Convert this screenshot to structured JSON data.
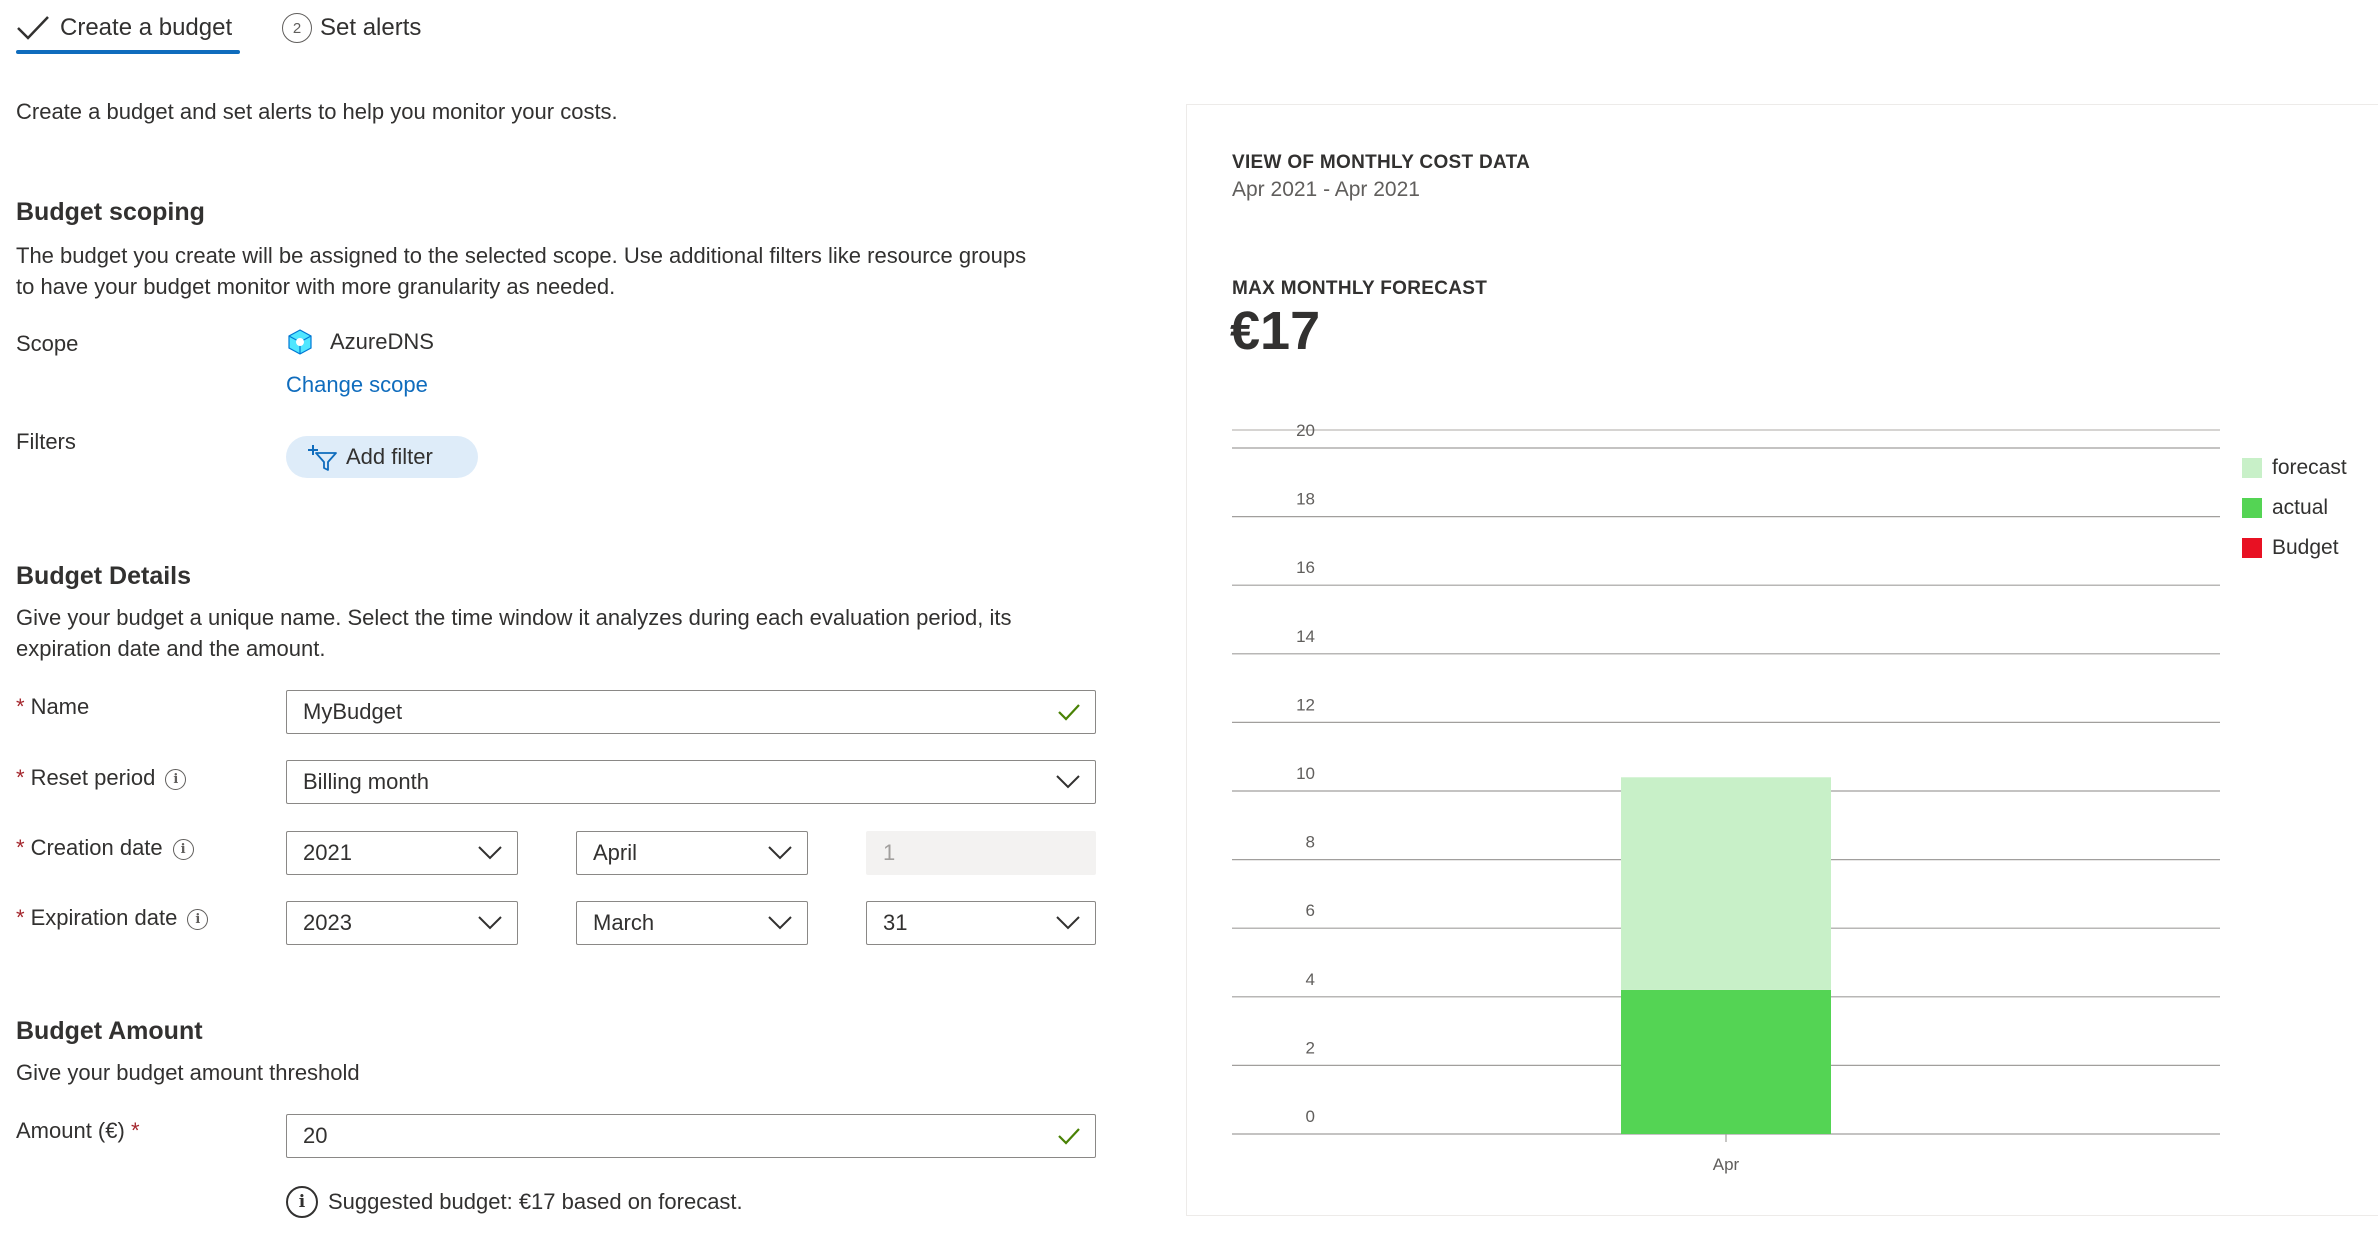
{
  "tabs": [
    {
      "label": "Create a budget",
      "active": true
    },
    {
      "label": "Set alerts",
      "step": "2"
    }
  ],
  "intro": "Create a budget and set alerts to help you monitor your costs.",
  "scoping": {
    "heading": "Budget scoping",
    "description_line1": "The budget you create will be assigned to the selected scope. Use additional filters like resource groups",
    "description_line2": "to have your budget monitor with more granularity as needed.",
    "scope_label": "Scope",
    "scope_value": "AzureDNS",
    "change_scope": "Change scope",
    "filters_label": "Filters",
    "add_filter": "Add filter"
  },
  "details": {
    "heading": "Budget Details",
    "description_line1": "Give your budget a unique name. Select the time window it analyzes during each evaluation period, its",
    "description_line2": "expiration date and the amount.",
    "required_mark": "*",
    "name_label": "Name",
    "name_value": "MyBudget",
    "reset_label": "Reset period",
    "reset_value": "Billing month",
    "creation_label": "Creation date",
    "creation_year": "2021",
    "creation_month": "April",
    "creation_day": "1",
    "expiration_label": "Expiration date",
    "expiration_year": "2023",
    "expiration_month": "March",
    "expiration_day": "31",
    "info_glyph": "i"
  },
  "amount": {
    "heading": "Budget Amount",
    "description": "Give your budget amount threshold",
    "amount_label": "Amount (€)",
    "amount_value": "20",
    "suggestion": "Suggested budget: €17 based on forecast."
  },
  "panel": {
    "title": "VIEW OF MONTHLY COST DATA",
    "range": "Apr 2021 - Apr 2021",
    "forecast_title": "MAX MONTHLY FORECAST",
    "forecast_value": "€17"
  },
  "colors": {
    "accent": "#0f6cbd",
    "forecast": "#c8f0c8",
    "actual": "#54d454",
    "budget": "#e81123",
    "valid_check": "#498205"
  },
  "chart_data": {
    "type": "bar",
    "categories": [
      "Apr"
    ],
    "series": [
      {
        "name": "actual",
        "values": [
          4.2
        ]
      },
      {
        "name": "forecast",
        "values": [
          6.2
        ]
      },
      {
        "name": "Budget",
        "values": []
      }
    ],
    "stacked": true,
    "ylim": [
      0,
      20
    ],
    "yticks": [
      0,
      2,
      4,
      6,
      8,
      10,
      12,
      14,
      16,
      18,
      20
    ],
    "legend": [
      "forecast",
      "actual",
      "Budget"
    ],
    "legend_position": "right",
    "grid": true
  }
}
